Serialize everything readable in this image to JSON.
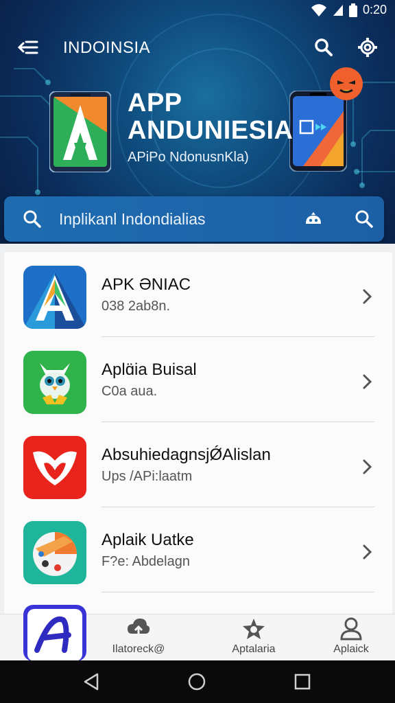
{
  "status_bar": {
    "time": "0:20"
  },
  "toolbar": {
    "title": "INDOINSIA"
  },
  "hero": {
    "title_line1": "APP",
    "title_line2": "ANDUNIESIA",
    "subtitle": "APiPo NdonusnKla)"
  },
  "search": {
    "text": "Inplikanl Indondialias"
  },
  "apps": [
    {
      "title": "APK ƏNIAC",
      "subtitle": "038 2ab8n.",
      "icon": "a-logo-icon"
    },
    {
      "title": "Aplɑ̈ia Buisal",
      "subtitle": "C0a aua.",
      "icon": "owl-icon"
    },
    {
      "title": "AbsuhiedagnsjǾAlislan",
      "subtitle": "Ups /APi:laatm",
      "icon": "heart-shield-icon"
    },
    {
      "title": "Aplaik Uatke",
      "subtitle": "F?e: Abdelagn",
      "icon": "palette-icon"
    }
  ],
  "bottom_nav": [
    {
      "label": "Ilatoreck@",
      "icon": "cloud-upload-icon"
    },
    {
      "label": "Aptalaria",
      "icon": "star-icon"
    },
    {
      "label": "Aplaick",
      "icon": "person-icon"
    }
  ],
  "colors": {
    "primary": "#1c5fa5",
    "hero_dark": "#0a1f44",
    "list_bg": "#fbfbfb"
  }
}
